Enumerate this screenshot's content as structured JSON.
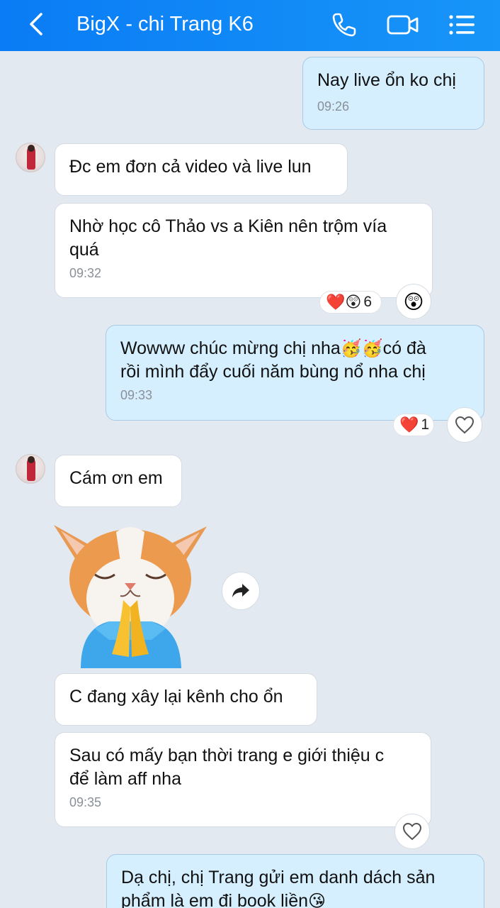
{
  "header": {
    "title": "BigX - chi Trang K6",
    "back_icon": "chevron-left-icon",
    "call_icon": "phone-icon",
    "video_icon": "video-camera-icon",
    "menu_icon": "list-menu-icon",
    "background": "#0a7cf5"
  },
  "messages": [
    {
      "id": "m1",
      "side": "out",
      "text": "Nay live ổn ko chị",
      "time": "09:26"
    },
    {
      "id": "m2",
      "side": "in",
      "text": "Đc em đơn cả video và live lun"
    },
    {
      "id": "m3",
      "side": "in",
      "text_line1": "Nhờ học cô Thảo vs a Kiên nên trộm vía",
      "text_line2": "quá",
      "time": "09:32",
      "reaction_count": "6",
      "reaction_emojis": "❤️😲"
    },
    {
      "id": "m4",
      "side": "out",
      "text_line1_a": "Wowww chúc mừng chị nha",
      "text_line1_emoji": "🥳🥳",
      "text_line1_b": "có đà",
      "text_line2": "rồi mình đẩy cuối năm bùng nổ nha chị",
      "time": "09:33",
      "reaction_count": "1",
      "reaction_emojis": "❤️"
    },
    {
      "id": "m5",
      "side": "in",
      "text": "Cám ơn em"
    },
    {
      "id": "m6",
      "side": "in",
      "type": "sticker",
      "sticker_name": "cat-praying-sticker"
    },
    {
      "id": "m7",
      "side": "in",
      "text": "C đang xây lại kênh cho ổn"
    },
    {
      "id": "m8",
      "side": "in",
      "text_line1": "Sau có mấy bạn thời trang e giới thiệu c",
      "text_line2": "để làm aff nha",
      "time": "09:35"
    },
    {
      "id": "m9",
      "side": "out",
      "text_line1": "Dạ chị, chị Trang gửi em danh dách sản",
      "text_line2_a": "phẩm là em đi book liền",
      "text_line2_emoji": "😘"
    }
  ],
  "colors": {
    "chat_background": "#e2e9f1",
    "outgoing_bubble": "#d5efff",
    "incoming_bubble": "#ffffff",
    "heart": "#e8232f"
  }
}
